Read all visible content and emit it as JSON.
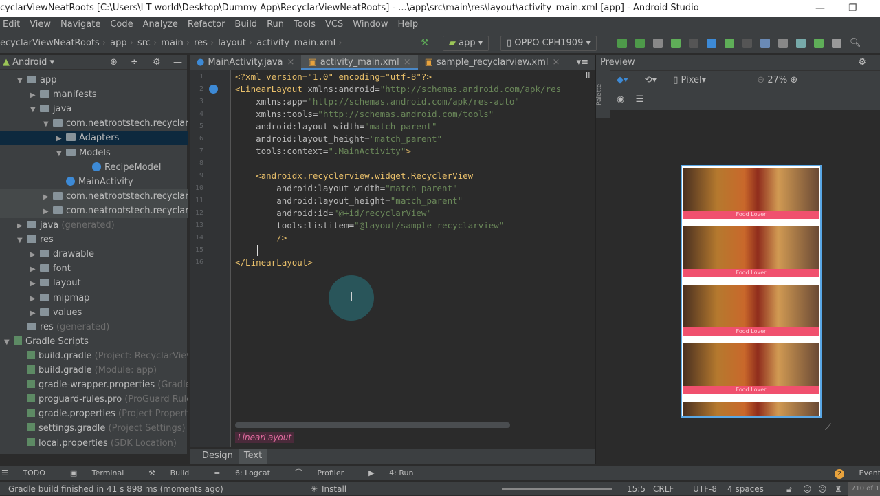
{
  "window": {
    "title": "cyclarViewNeatRoots [C:\\Users\\I T world\\Desktop\\Dummy App\\RecyclarViewNeatRoots] - ...\\app\\src\\main\\res\\layout\\activity_main.xml [app] - Android Studio"
  },
  "menu": [
    "Edit",
    "View",
    "Navigate",
    "Code",
    "Analyze",
    "Refactor",
    "Build",
    "Run",
    "Tools",
    "VCS",
    "Window",
    "Help"
  ],
  "breadcrumb": [
    "ecyclarViewNeatRoots",
    "app",
    "src",
    "main",
    "res",
    "layout",
    "activity_main.xml"
  ],
  "toolbar": {
    "run_config": "app",
    "device": "OPPO CPH1909"
  },
  "project": {
    "view": "Android",
    "tree": [
      {
        "label": "app",
        "depth": 0,
        "arrow": "▼",
        "icon": "folder"
      },
      {
        "label": "manifests",
        "depth": 1,
        "arrow": "▶",
        "icon": "folder"
      },
      {
        "label": "java",
        "depth": 1,
        "arrow": "▼",
        "icon": "folder"
      },
      {
        "label": "com.neatrootstech.recyclarviewn",
        "depth": 2,
        "arrow": "▼",
        "icon": "folder"
      },
      {
        "label": "Adapters",
        "depth": 3,
        "arrow": "▶",
        "icon": "folder",
        "selected": true
      },
      {
        "label": "Models",
        "depth": 3,
        "arrow": "▼",
        "icon": "folder"
      },
      {
        "label": "RecipeModel",
        "depth": 5,
        "arrow": "",
        "icon": "class"
      },
      {
        "label": "MainActivity",
        "depth": 3,
        "arrow": "",
        "icon": "class"
      },
      {
        "label": "com.neatrootstech.recyclarviewn",
        "depth": 2,
        "arrow": "▶",
        "icon": "folder",
        "hl": true
      },
      {
        "label": "com.neatrootstech.recyclarviewn",
        "depth": 2,
        "arrow": "▶",
        "icon": "folder",
        "hl": true
      },
      {
        "label": "java",
        "suffix": " (generated)",
        "depth": 0,
        "arrow": "▶",
        "icon": "folder"
      },
      {
        "label": "res",
        "depth": 0,
        "arrow": "▼",
        "icon": "folder"
      },
      {
        "label": "drawable",
        "depth": 1,
        "arrow": "▶",
        "icon": "folder"
      },
      {
        "label": "font",
        "depth": 1,
        "arrow": "▶",
        "icon": "folder"
      },
      {
        "label": "layout",
        "depth": 1,
        "arrow": "▶",
        "icon": "folder"
      },
      {
        "label": "mipmap",
        "depth": 1,
        "arrow": "▶",
        "icon": "folder"
      },
      {
        "label": "values",
        "depth": 1,
        "arrow": "▶",
        "icon": "folder"
      },
      {
        "label": "res",
        "suffix": " (generated)",
        "depth": 0,
        "arrow": "",
        "icon": "folder"
      },
      {
        "label": "Gradle Scripts",
        "depth": -1,
        "arrow": "▼",
        "icon": "gradle"
      },
      {
        "label": "build.gradle",
        "suffix": " (Project: RecyclarViewN",
        "depth": 0,
        "arrow": "",
        "icon": "gradle"
      },
      {
        "label": "build.gradle",
        "suffix": " (Module: app)",
        "depth": 0,
        "arrow": "",
        "icon": "gradle"
      },
      {
        "label": "gradle-wrapper.properties",
        "suffix": " (Gradle V",
        "depth": 0,
        "arrow": "",
        "icon": "gradle"
      },
      {
        "label": "proguard-rules.pro",
        "suffix": " (ProGuard Rules",
        "depth": 0,
        "arrow": "",
        "icon": "gradle"
      },
      {
        "label": "gradle.properties",
        "suffix": " (Project Properties",
        "depth": 0,
        "arrow": "",
        "icon": "gradle"
      },
      {
        "label": "settings.gradle",
        "suffix": " (Project Settings)",
        "depth": 0,
        "arrow": "",
        "icon": "gradle"
      },
      {
        "label": "local.properties",
        "suffix": " (SDK Location)",
        "depth": 0,
        "arrow": "",
        "icon": "gradle"
      }
    ]
  },
  "editor": {
    "tabs": [
      {
        "label": "MainActivity.java",
        "active": false
      },
      {
        "label": "activity_main.xml",
        "active": true
      },
      {
        "label": "sample_recyclarview.xml",
        "active": false
      }
    ],
    "lines": [
      [
        [
          "pi",
          "<?xml version=\"1.0\" encoding=\"utf-8\"?>"
        ]
      ],
      [
        [
          "tag",
          "<LinearLayout "
        ],
        [
          "att",
          "xmlns:android="
        ],
        [
          "val",
          "\"http://schemas.android.com/apk/res"
        ]
      ],
      [
        [
          "att",
          "    xmlns:app="
        ],
        [
          "val",
          "\"http://schemas.android.com/apk/res-auto\""
        ]
      ],
      [
        [
          "att",
          "    xmlns:tools="
        ],
        [
          "val",
          "\"http://schemas.android.com/tools\""
        ]
      ],
      [
        [
          "att",
          "    android:layout_width="
        ],
        [
          "val",
          "\"match_parent\""
        ]
      ],
      [
        [
          "att",
          "    android:layout_height="
        ],
        [
          "val",
          "\"match_parent\""
        ]
      ],
      [
        [
          "att",
          "    tools:context="
        ],
        [
          "val",
          "\".MainActivity\""
        ],
        [
          "tag",
          ">"
        ]
      ],
      [],
      [
        [
          "tag",
          "    <androidx.recyclerview.widget.RecyclerView"
        ]
      ],
      [
        [
          "att",
          "        android:layout_width="
        ],
        [
          "val",
          "\"match_parent\""
        ]
      ],
      [
        [
          "att",
          "        android:layout_height="
        ],
        [
          "val",
          "\"match_parent\""
        ]
      ],
      [
        [
          "att",
          "        android:id="
        ],
        [
          "val",
          "\"@+id/recyclarView\""
        ]
      ],
      [
        [
          "att",
          "        tools:listitem="
        ],
        [
          "val",
          "\"@layout/sample_recyclarview\""
        ]
      ],
      [
        [
          "tag",
          "        />"
        ]
      ],
      [],
      [
        [
          "tag",
          "</LinearLayout>"
        ]
      ]
    ],
    "breadcrumb_hint": "LinearLayout",
    "mode_tabs": [
      "Design",
      "Text"
    ]
  },
  "preview": {
    "title": "Preview",
    "palette": "Palette",
    "device": "Pixel",
    "zoom": "27%",
    "item_label": "Food Lover",
    "item_count": 5
  },
  "toolwindows": [
    "TODO",
    "Terminal",
    "Build",
    "6: Logcat",
    "Profiler",
    "4: Run"
  ],
  "event_log": {
    "count": "2",
    "label": "Event Log"
  },
  "status": {
    "message": "Gradle build finished in 41 s 898 ms (moments ago)",
    "task": "Install",
    "position": "15:5",
    "line_sep": "CRLF",
    "encoding": "UTF-8",
    "indent": "4 spaces",
    "memory": "710 of 1"
  }
}
